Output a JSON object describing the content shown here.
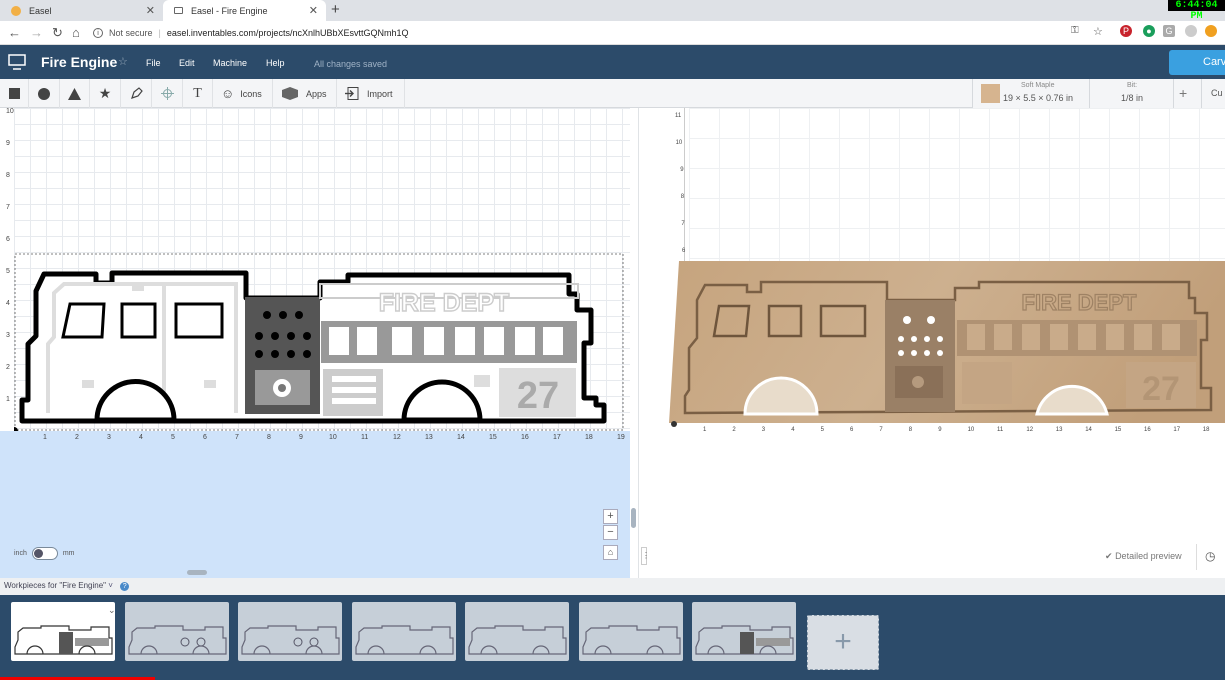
{
  "browser": {
    "tabs": [
      {
        "title": "Easel"
      },
      {
        "title": "Easel - Fire Engine"
      }
    ],
    "security": "Not secure",
    "url": "easel.inventables.com/projects/ncXnlhUBbXEsvttGQNmh1Q",
    "clock": "6:44:04 PM"
  },
  "app": {
    "title": "Fire Engine",
    "menu": [
      "File",
      "Edit",
      "Machine",
      "Help"
    ],
    "status": "All changes saved",
    "carve_label": "Carv"
  },
  "toolbar": {
    "icons_label": "Icons",
    "apps_label": "Apps",
    "import_label": "Import"
  },
  "material": {
    "name": "Soft Maple",
    "size": "19 × 5.5 × 0.76 in",
    "bit_label": "Bit:",
    "bit_value": "1/8 in",
    "cut_label": "Cu"
  },
  "design": {
    "y_ticks": [
      "10",
      "9",
      "8",
      "7",
      "6",
      "5",
      "4",
      "3",
      "2",
      "1"
    ],
    "x_ticks": [
      "1",
      "2",
      "3",
      "4",
      "5",
      "6",
      "7",
      "8",
      "9",
      "10",
      "11",
      "12",
      "13",
      "14",
      "15",
      "16",
      "17",
      "18",
      "19"
    ],
    "unit_left": "inch",
    "unit_right": "mm",
    "sign_text": "FIRE DEPT",
    "number_text": "27"
  },
  "preview": {
    "y_ticks": [
      "11",
      "10",
      "9",
      "8",
      "7",
      "6"
    ],
    "x_ticks": [
      "1",
      "2",
      "3",
      "4",
      "5",
      "6",
      "7",
      "8",
      "9",
      "10",
      "11",
      "12",
      "13",
      "14",
      "15",
      "16",
      "17",
      "18"
    ],
    "detailed_label": "Detailed preview"
  },
  "workpieces": {
    "label": "Workpieces for \"Fire Engine\"",
    "count": 7
  },
  "colors": {
    "header": "#2c4b6a",
    "canvas_bg": "#cfe3fa",
    "wood": "#c9a982",
    "accent": "#3aa0e0"
  }
}
